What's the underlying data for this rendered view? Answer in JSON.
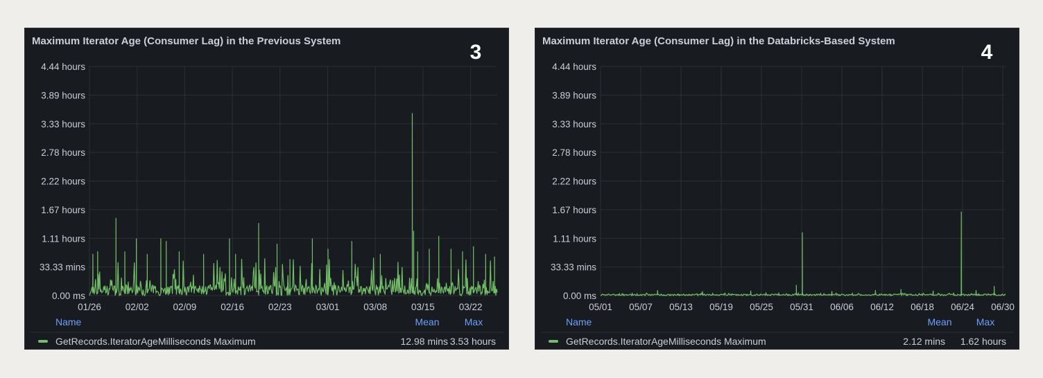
{
  "chart_data": [
    {
      "type": "line",
      "title": "Maximum Iterator Age (Consumer Lag) in the Previous System",
      "badge": "3",
      "ylabel": "",
      "ylim_hours": [
        0,
        4.44
      ],
      "yticks": [
        "0.00 ms",
        "33.33 mins",
        "1.11 hours",
        "1.67 hours",
        "2.22 hours",
        "2.78 hours",
        "3.33 hours",
        "3.89 hours",
        "4.44 hours"
      ],
      "xticks": [
        "01/26",
        "02/02",
        "02/09",
        "02/16",
        "02/23",
        "03/01",
        "03/08",
        "03/15",
        "03/22"
      ],
      "x_range_days": [
        0,
        60
      ],
      "series": [
        {
          "name": "GetRecords.IteratorAgeMilliseconds Maximum",
          "color": "#73bf69",
          "baseline_max_hours": 0.35,
          "spikes_day_hours": [
            [
              0.5,
              0.8
            ],
            [
              1.2,
              0.85
            ],
            [
              3.9,
              1.5
            ],
            [
              5.2,
              0.85
            ],
            [
              6.9,
              1.1
            ],
            [
              8.5,
              0.8
            ],
            [
              10.5,
              1.1
            ],
            [
              11.3,
              1.05
            ],
            [
              13.2,
              0.85
            ],
            [
              16.8,
              0.8
            ],
            [
              20.6,
              1.1
            ],
            [
              21.5,
              0.8
            ],
            [
              24.9,
              1.4
            ],
            [
              27.6,
              1.0
            ],
            [
              29.5,
              0.7
            ],
            [
              32.8,
              1.1
            ],
            [
              35.1,
              0.9
            ],
            [
              38.6,
              1.05
            ],
            [
              42.8,
              0.8
            ],
            [
              47.5,
              3.53
            ],
            [
              47.7,
              1.25
            ],
            [
              48.3,
              0.85
            ],
            [
              50.0,
              0.9
            ],
            [
              51.4,
              1.15
            ],
            [
              53.2,
              0.9
            ],
            [
              54.9,
              0.85
            ],
            [
              56.5,
              0.95
            ],
            [
              58.3,
              0.8
            ],
            [
              59.6,
              0.75
            ]
          ]
        }
      ],
      "legend": {
        "headers": [
          "Name",
          "Mean",
          "Max"
        ],
        "row": {
          "mean": "12.98 mins",
          "max": "3.53 hours"
        }
      }
    },
    {
      "type": "line",
      "title": "Maximum Iterator Age (Consumer Lag) in the Databricks-Based System",
      "badge": "4",
      "ylim_hours": [
        0,
        4.44
      ],
      "yticks": [
        "0.00 ms",
        "33.33 mins",
        "1.11 hours",
        "1.67 hours",
        "2.22 hours",
        "2.78 hours",
        "3.33 hours",
        "3.89 hours",
        "4.44 hours"
      ],
      "xticks": [
        "05/01",
        "05/07",
        "05/13",
        "05/19",
        "05/25",
        "05/31",
        "06/06",
        "06/12",
        "06/18",
        "06/24",
        "06/30"
      ],
      "x_range_days": [
        0,
        60.4
      ],
      "series": [
        {
          "name": "GetRecords.IteratorAgeMilliseconds Maximum",
          "color": "#73bf69",
          "baseline_max_hours": 0.05,
          "spikes_day_hours": [
            [
              8.5,
              0.1
            ],
            [
              15.2,
              0.08
            ],
            [
              22.4,
              0.09
            ],
            [
              29.2,
              0.2
            ],
            [
              30.1,
              1.22
            ],
            [
              34.5,
              0.08
            ],
            [
              41.0,
              0.1
            ],
            [
              44.8,
              0.12
            ],
            [
              49.6,
              0.09
            ],
            [
              53.8,
              1.62
            ],
            [
              56.0,
              0.1
            ],
            [
              58.7,
              0.18
            ]
          ]
        }
      ],
      "legend": {
        "headers": [
          "Name",
          "Mean",
          "Max"
        ],
        "row": {
          "mean": "2.12 mins",
          "max": "1.62 hours"
        }
      }
    }
  ]
}
